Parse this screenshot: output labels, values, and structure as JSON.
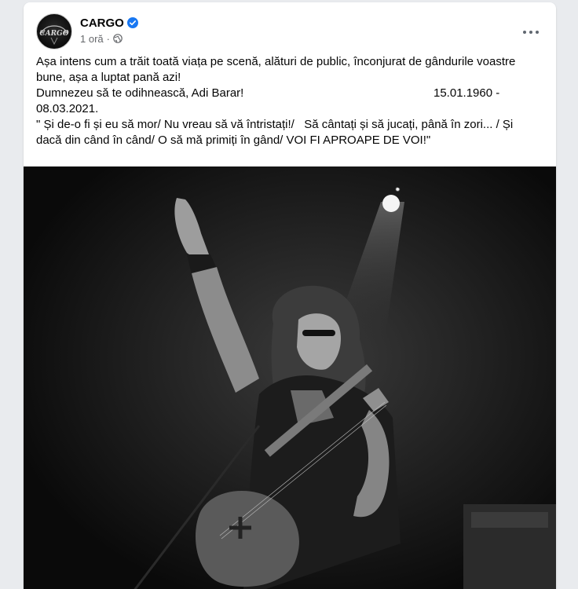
{
  "post": {
    "author": "CARGO",
    "time": "1 oră",
    "privacy_icon": "globe-icon",
    "verified_icon": "verified-badge-icon",
    "avatar_logo_text": "CARGO",
    "text_line1": "Așa intens cum a trăit toată viața pe scenă, alături de public, înconjurat de gândurile voastre bune, așa a luptat pană azi!",
    "text_line2_left": "Dumnezeu să te odihnească, Adi Barar!",
    "text_line2_right": "15.01.1960 -",
    "text_line3": "08.03.2021.",
    "text_line4": "\" Și de-o fi și eu să mor/ Nu vreau să vă întristați!/   Să cântați și să jucați, până în zori... / Și dacă din când în când/ O să mă primiți în gând/ VOI FI APROAPE DE VOI!\"",
    "more_icon": "more-options-icon"
  },
  "photo": {
    "subject": "guitarist-on-stage-photo",
    "style": "black-and-white"
  },
  "colors": {
    "verified_blue": "#1877f2",
    "meta_gray": "#65676b",
    "text": "#050505",
    "background": "#e9ebee"
  }
}
